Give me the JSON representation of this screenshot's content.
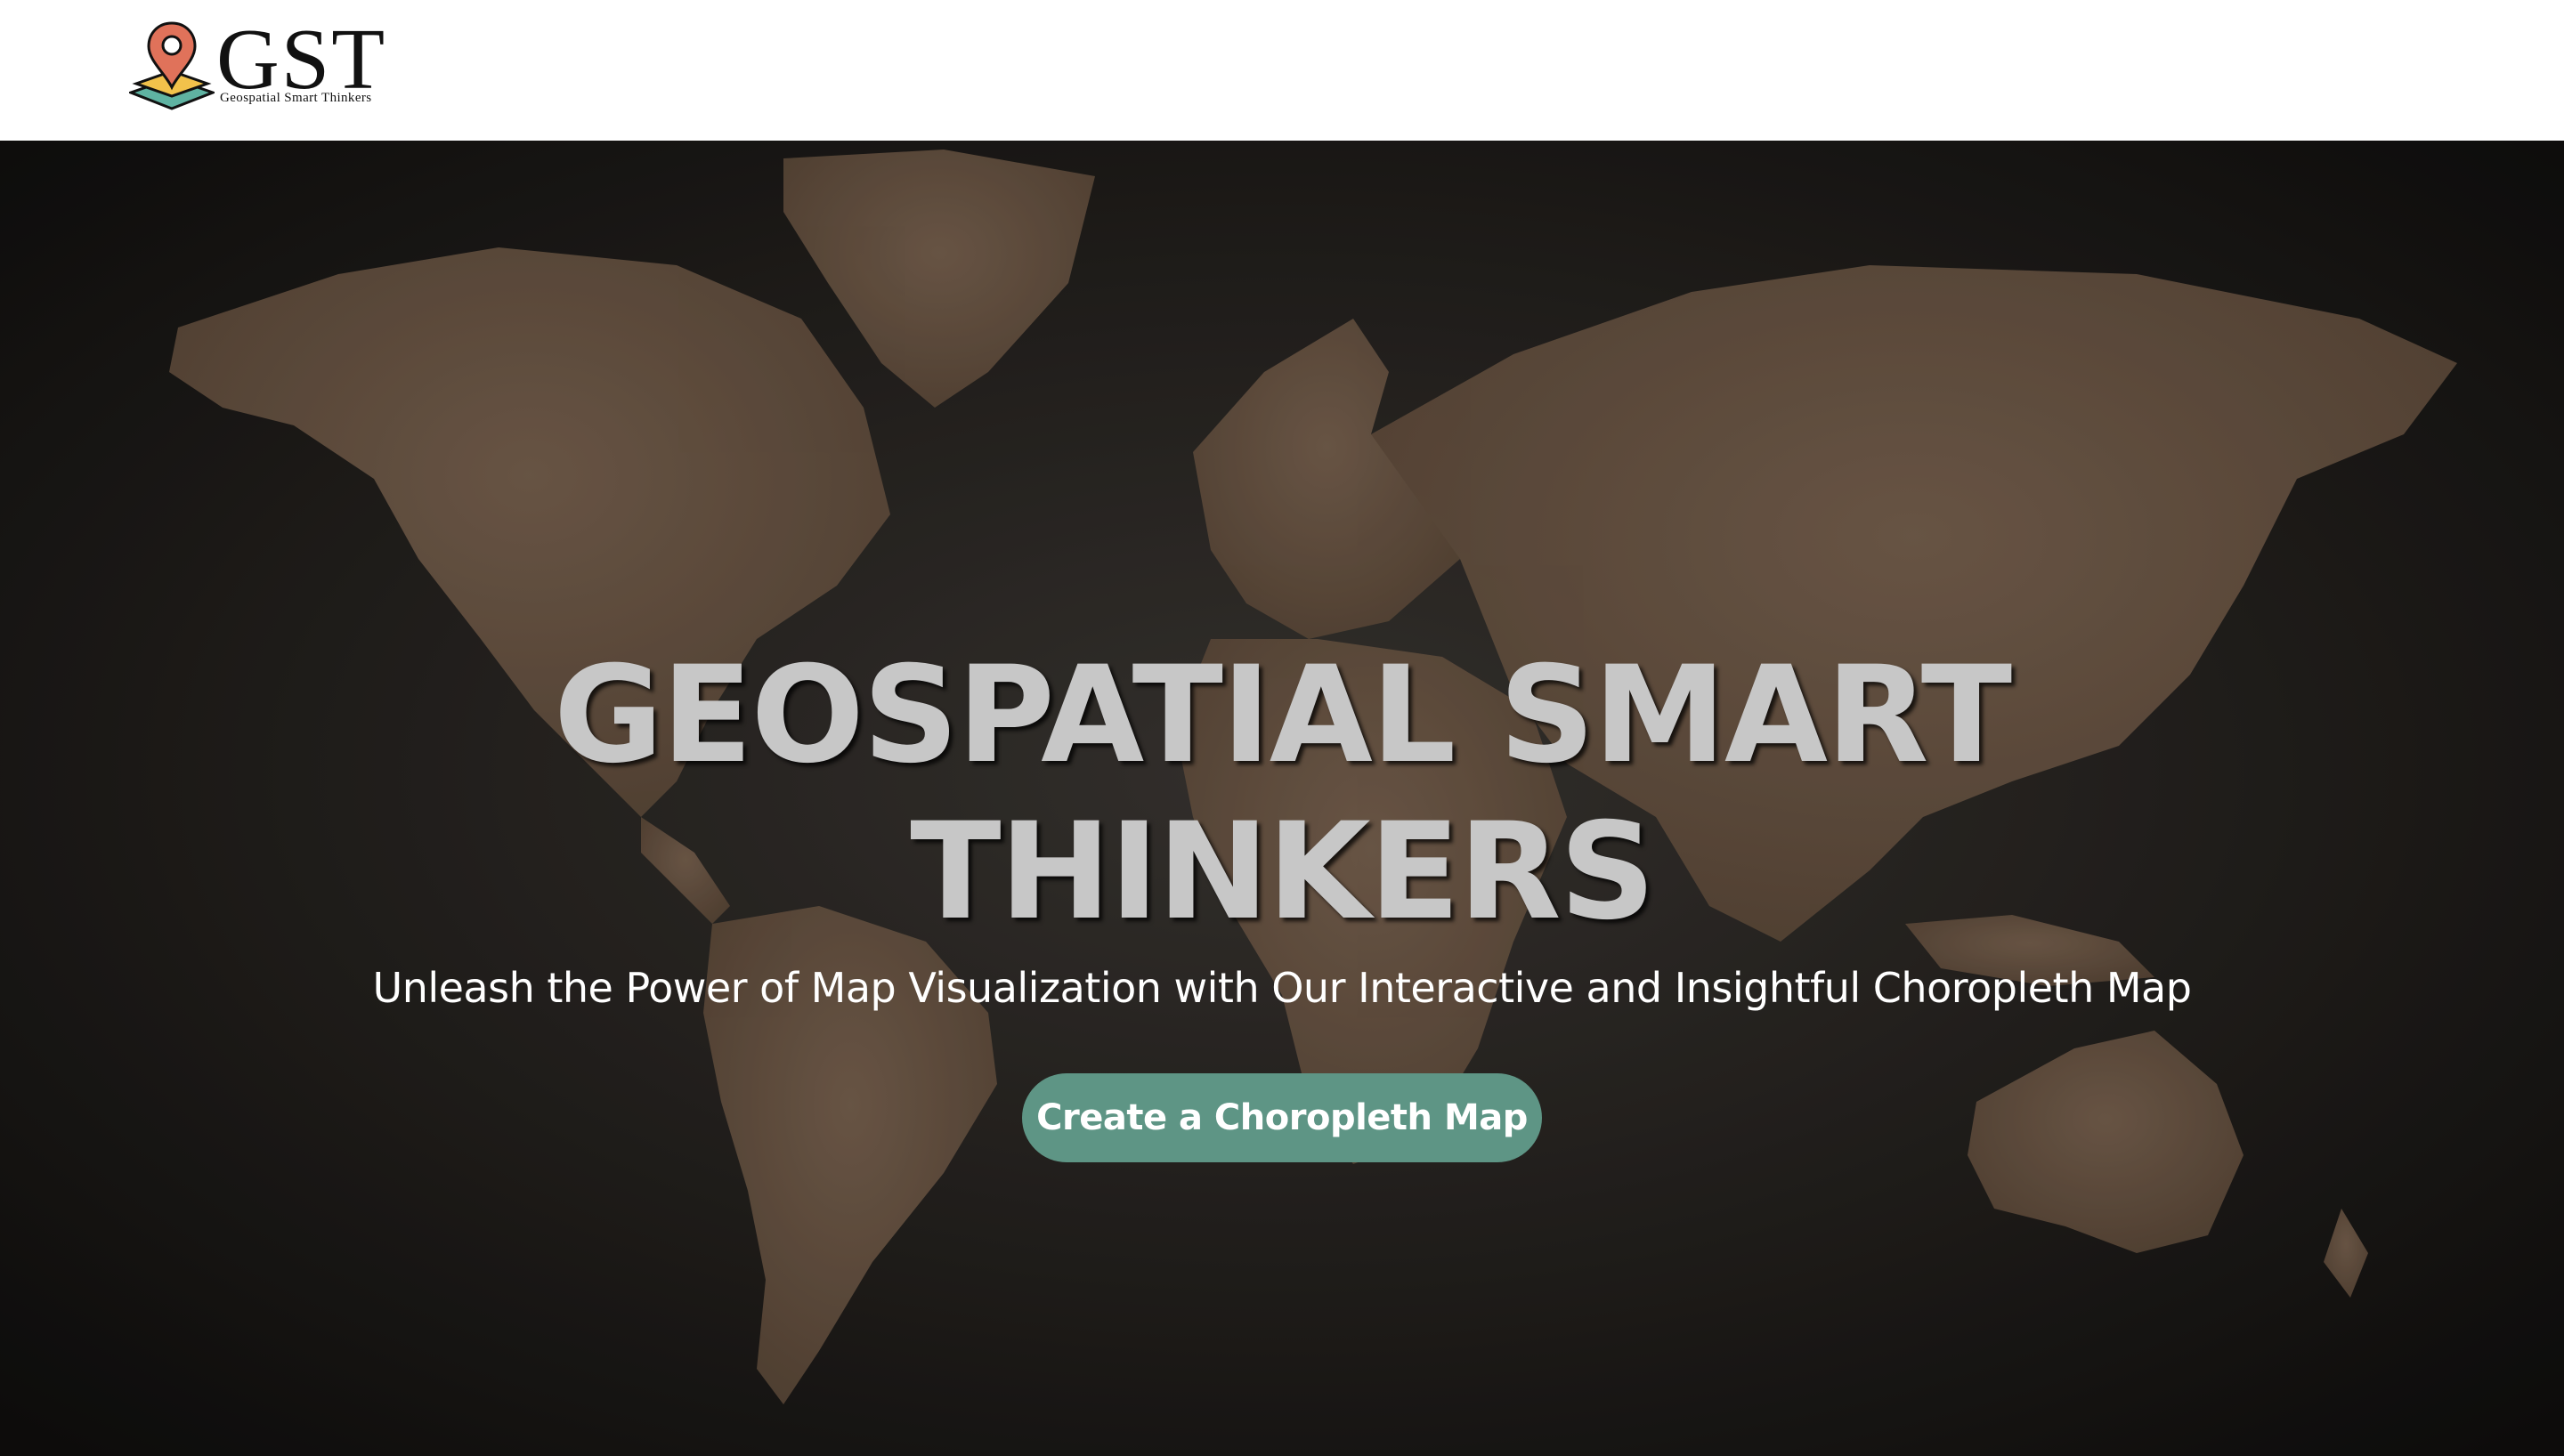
{
  "header": {
    "logo": {
      "text": "GST",
      "subtitle": "Geospatial Smart Thinkers",
      "icon": "map-pin-layers-icon"
    }
  },
  "hero": {
    "title_line1": "GEOSPATIAL SMART",
    "title_line2": "THINKERS",
    "subtitle": "Unleash the Power of Map Visualization with Our Interactive and Insightful Choropleth Map",
    "cta_label": "Create a Choropleth Map",
    "background": "world-map-image"
  },
  "colors": {
    "accent": "#5e9585",
    "map_land": "#6b5644",
    "background": "#1b1917",
    "title": "#c7c7c7",
    "pin": "#e0725a",
    "layer_green": "#5fb3a2"
  }
}
